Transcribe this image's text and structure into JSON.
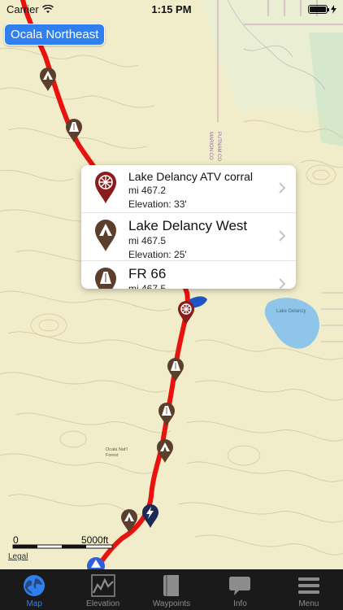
{
  "status_bar": {
    "carrier": "Carrier",
    "time": "1:15 PM"
  },
  "region_label": "Ocala Northeast",
  "popup": {
    "items": [
      {
        "title": "Lake Delancy ATV corral",
        "mile": "mi 467.2",
        "elevation": "Elevation: 33'",
        "icon": "campsite-marker-icon",
        "color": "#8a1c1c"
      },
      {
        "title": "Lake Delancy West",
        "mile": "mi 467.5",
        "elevation": "Elevation: 25'",
        "icon": "tent-marker-icon",
        "color": "#5b3e2b"
      },
      {
        "title": "FR 66",
        "mile": "mi 467.5",
        "icon": "road-marker-icon",
        "color": "#5b3e2b"
      }
    ]
  },
  "map": {
    "scale_start": "0",
    "scale_end": "5000ft",
    "legal": "Legal",
    "map_labels": {
      "lake": "Lake Delancy",
      "forest_text_1": "MARION CO",
      "forest_text_2": "PUTNAM CO",
      "campsite_note_1": "Ocala Nat'l",
      "campsite_note_2": "Forest"
    },
    "trail_color": "#e8120f",
    "water_color": "#8fc5e8"
  },
  "tabbar": {
    "tabs": [
      {
        "label": "Map",
        "icon": "globe-icon",
        "active": true
      },
      {
        "label": "Elevation",
        "icon": "elevation-chart-icon",
        "active": false
      },
      {
        "label": "Waypoints",
        "icon": "book-icon",
        "active": false
      },
      {
        "label": "Info",
        "icon": "speech-bubble-icon",
        "active": false
      },
      {
        "label": "Menu",
        "icon": "hamburger-menu-icon",
        "active": false
      }
    ]
  }
}
